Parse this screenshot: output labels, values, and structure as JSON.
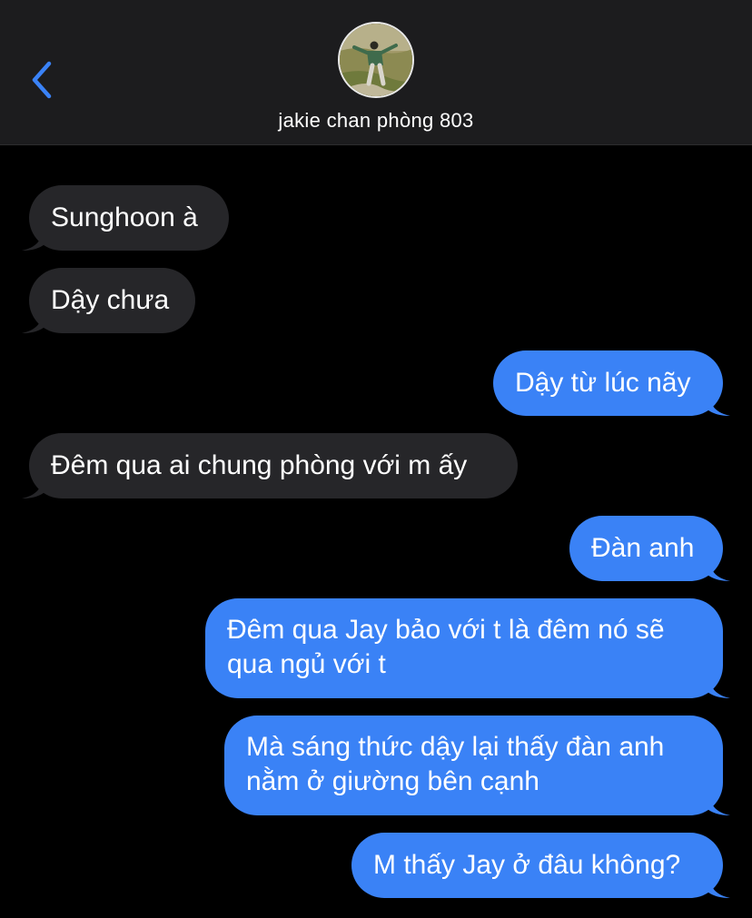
{
  "header": {
    "contact_name": "jakie chan phòng 803",
    "back_icon": "chevron-left-icon",
    "accent_color": "#3a82f6"
  },
  "messages": [
    {
      "direction": "incoming",
      "text": "Sunghoon à"
    },
    {
      "direction": "incoming",
      "text": "Dậy chưa"
    },
    {
      "direction": "outgoing",
      "text": "Dậy từ lúc nãy"
    },
    {
      "direction": "incoming",
      "text": "Đêm qua ai chung phòng với m ấy"
    },
    {
      "direction": "outgoing",
      "text": "Đàn anh"
    },
    {
      "direction": "outgoing",
      "lines": [
        "Đêm qua Jay bảo với t là đêm nó sẽ",
        "qua ngủ với t"
      ]
    },
    {
      "direction": "outgoing",
      "lines": [
        "Mà sáng thức dậy lại thấy đàn anh",
        "nằm ở giường bên cạnh"
      ]
    },
    {
      "direction": "outgoing",
      "text": "M thấy Jay ở đâu không?"
    }
  ],
  "colors": {
    "incoming_bubble": "#262629",
    "outgoing_bubble": "#3a82f6",
    "background": "#000000",
    "header_background": "#1c1c1e"
  }
}
